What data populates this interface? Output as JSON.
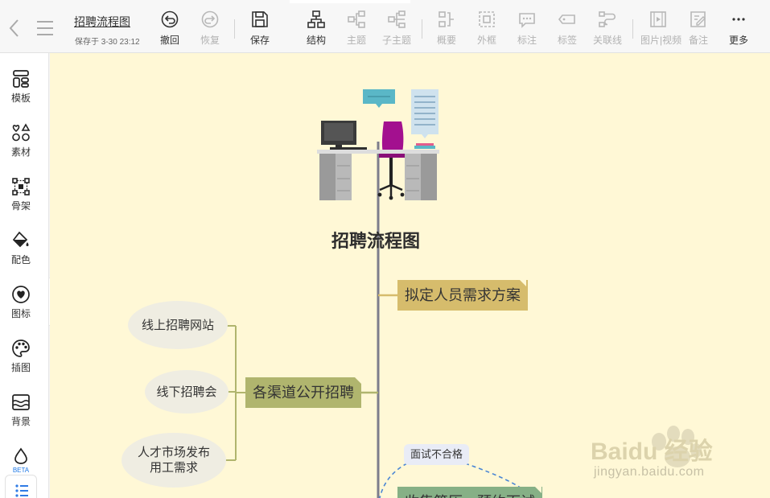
{
  "toolbar": {
    "doc_title": "招聘流程图",
    "saved_status": "保存于 3-30 23:12",
    "tools": {
      "undo": "撤回",
      "redo": "恢复",
      "save": "保存",
      "structure": "结构",
      "topic": "主题",
      "subtopic": "子主题",
      "summary": "概要",
      "frame": "外框",
      "callout": "标注",
      "tag": "标签",
      "relation": "关联线",
      "media": "图片|视频",
      "note": "备注",
      "more": "更多"
    }
  },
  "sidebar": {
    "templates": "模板",
    "materials": "素材",
    "skeleton": "骨架",
    "colors": "配色",
    "icons": "图标",
    "illustrations": "插图",
    "background": "背景",
    "beta": "BETA"
  },
  "mindmap": {
    "root": "招聘流程图",
    "topic_1": "拟定人员需求方案",
    "topic_2": "各渠道公开招聘",
    "topic_3": "收集简历，预约面试",
    "leaves": {
      "online": "线上招聘网站",
      "offline": "线下招聘会",
      "talent_market_line1": "人才市场发布",
      "talent_market_line2": "用工需求"
    },
    "relation_label": "面试不合格"
  },
  "watermark": {
    "brand": "Baidu 经验",
    "url": "jingyan.baidu.com"
  },
  "colors": {
    "canvas_bg": "#fff8d6",
    "topic_1": "#d6bc6c",
    "topic_2": "#b0b56e",
    "topic_3": "#86b086",
    "leaf_bg": "#efede2",
    "spine": "#7d7d8c",
    "relation_line": "#4a86d4"
  }
}
